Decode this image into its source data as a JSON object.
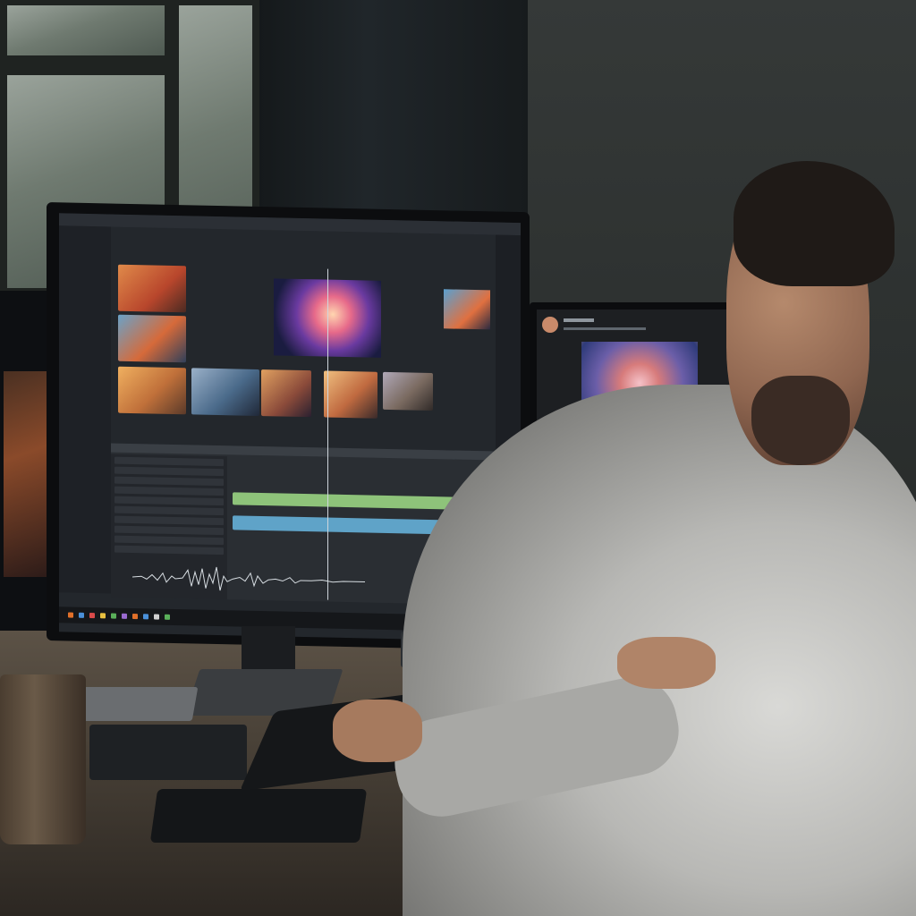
{
  "scene": {
    "main_monitor": {
      "menu_items": [
        "",
        "",
        "",
        "",
        "",
        ""
      ],
      "preview_label": "",
      "timeline_label": ""
    },
    "second_monitor": {
      "post_actions": [
        "like-icon",
        "comment-icon",
        "share-icon",
        "bookmark-icon"
      ]
    }
  },
  "colors": {
    "clip_green": "#8ec37a",
    "clip_blue": "#5fa3c8",
    "like_red": "#e04a4a"
  }
}
